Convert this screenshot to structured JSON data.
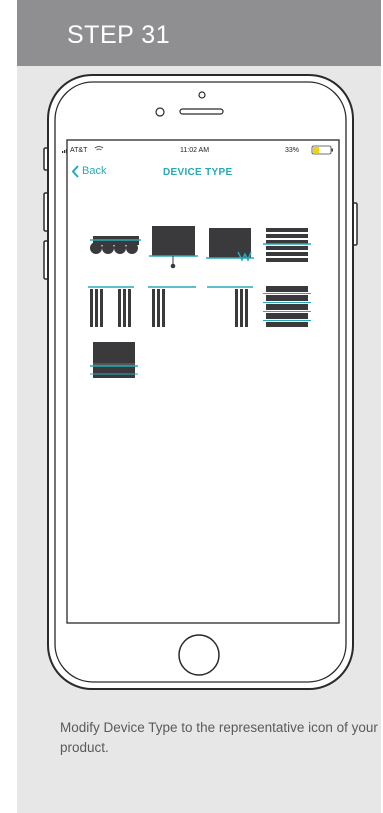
{
  "step": {
    "title": "STEP 31"
  },
  "phone": {
    "status_bar": {
      "carrier": "AT&T",
      "time": "11:02 AM",
      "battery": "33%"
    },
    "nav": {
      "back_label": "Back",
      "title": "DEVICE TYPE"
    },
    "device_icons": [
      "awning-icon",
      "roller-shade-chain-icon",
      "roller-shade-motor-icon",
      "horizontal-blinds-icon",
      "drapery-split-icon",
      "drapery-left-icon",
      "drapery-right-icon",
      "louvered-blinds-icon",
      "roman-shade-icon"
    ]
  },
  "caption": "Modify Device Type to the representative icon of your product.",
  "colors": {
    "accent": "#29a9b8",
    "header_bg": "#8f8f91",
    "card_bg": "#e7e7e8",
    "icon_dark": "#3a3a3c"
  }
}
